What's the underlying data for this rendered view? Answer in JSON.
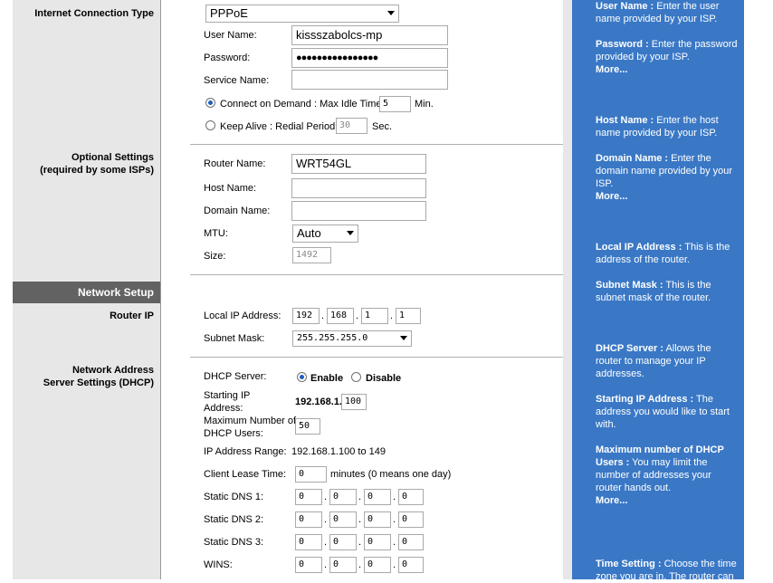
{
  "sections": {
    "internet_connection_type": "Internet Connection Type",
    "optional_settings": "Optional Settings",
    "optional_settings_note": "(required by some ISPs)",
    "network_setup": "Network Setup",
    "router_ip": "Router IP",
    "dhcp_line1": "Network Address",
    "dhcp_line2": "Server Settings (DHCP)"
  },
  "connection": {
    "type_value": "PPPoE",
    "username_label": "User Name:",
    "username_value": "kissszabolcs-mp",
    "password_label": "Password:",
    "password_value": "●●●●●●●●●●●●●●●●",
    "service_name_label": "Service Name:",
    "service_name_value": "",
    "connect_on_demand_label": "Connect on Demand : Max Idle Time",
    "max_idle_value": "5",
    "max_idle_unit": "Min.",
    "keep_alive_label": "Keep Alive : Redial Period",
    "redial_value": "30",
    "redial_unit": "Sec."
  },
  "optional": {
    "router_name_label": "Router Name:",
    "router_name_value": "WRT54GL",
    "host_name_label": "Host Name:",
    "host_name_value": "",
    "domain_name_label": "Domain Name:",
    "domain_name_value": "",
    "mtu_label": "MTU:",
    "mtu_value": "Auto",
    "size_label": "Size:",
    "size_value": "1492"
  },
  "router_ip": {
    "local_ip_label": "Local IP Address:",
    "ip": [
      "192",
      "168",
      "1",
      "1"
    ],
    "subnet_label": "Subnet Mask:",
    "subnet_value": "255.255.255.0"
  },
  "dhcp": {
    "server_label": "DHCP Server:",
    "enable_label": "Enable",
    "disable_label": "Disable",
    "starting_ip_label_1": "Starting IP",
    "starting_ip_label_2": "Address:",
    "starting_ip_prefix": "192.168.1.",
    "starting_ip_value": "100",
    "max_users_label_1": "Maximum Number of",
    "max_users_label_2": "DHCP Users:",
    "max_users_value": "50",
    "ip_range_label": "IP Address Range:",
    "ip_range_value": "192.168.1.100 to 149",
    "lease_label": "Client Lease Time:",
    "lease_value": "0",
    "lease_note": "minutes (0 means one day)",
    "dns1_label": "Static DNS 1:",
    "dns1": [
      "0",
      "0",
      "0",
      "0"
    ],
    "dns2_label": "Static DNS 2:",
    "dns2": [
      "0",
      "0",
      "0",
      "0"
    ],
    "dns3_label": "Static DNS 3:",
    "dns3": [
      "0",
      "0",
      "0",
      "0"
    ],
    "wins_label": "WINS:",
    "wins": [
      "0",
      "0",
      "0",
      "0"
    ]
  },
  "help": {
    "username_title": "User Name :",
    "username_text": " Enter the user name provided by your ISP.",
    "password_title": "Password :",
    "password_text": " Enter the password provided by your ISP.",
    "more1": "More...",
    "hostname_title": "Host Name :",
    "hostname_text": " Enter the host name provided by your ISP.",
    "domain_title": "Domain Name :",
    "domain_text": " Enter the domain name provided by your ISP.",
    "more2": "More...",
    "localip_title": "Local IP Address :",
    "localip_text": " This is the address of the router.",
    "subnet_title": "Subnet Mask :",
    "subnet_text": " This is the subnet mask of the router.",
    "dhcp_title": "DHCP Server :",
    "dhcp_text": " Allows the router to manage your IP addresses.",
    "startip_title": "Starting IP Address :",
    "startip_text": " The address you would like to start with.",
    "maxdhcp_title": "Maximum number of DHCP Users :",
    "maxdhcp_text": " You may limit the number of addresses your router hands out.",
    "more3": "More...",
    "time_title": "Time Setting :",
    "time_text": " Choose the time zone you are in. The router can"
  }
}
